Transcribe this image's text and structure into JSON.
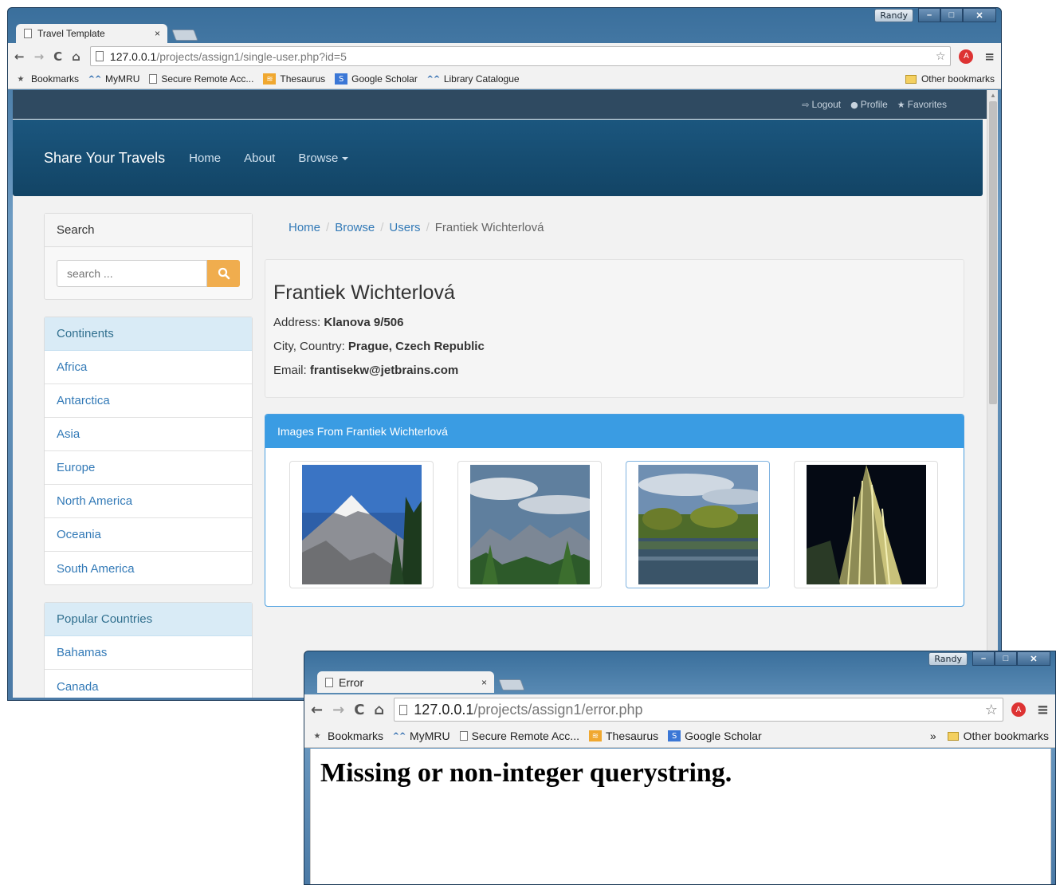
{
  "window1": {
    "profile": "Randy",
    "tab_title": "Travel Template",
    "url_host": "127.0.0.1",
    "url_path": "/projects/assign1/single-user.php?id=5",
    "bookmarks": [
      "Bookmarks",
      "MyMRU",
      "Secure Remote Acc...",
      "Thesaurus",
      "Google Scholar",
      "Library Catalogue"
    ],
    "other_bookmarks": "Other bookmarks",
    "page": {
      "top_links": [
        "Logout",
        "Profile",
        "Favorites"
      ],
      "brand": "Share Your Travels",
      "nav": [
        "Home",
        "About",
        "Browse"
      ],
      "search": {
        "title": "Search",
        "placeholder": "search ..."
      },
      "continents": {
        "title": "Continents",
        "items": [
          "Africa",
          "Antarctica",
          "Asia",
          "Europe",
          "North America",
          "Oceania",
          "South America"
        ]
      },
      "popular": {
        "title": "Popular Countries",
        "items": [
          "Bahamas",
          "Canada"
        ]
      },
      "breadcrumb": [
        "Home",
        "Browse",
        "Users",
        "Frantiek Wichterlová"
      ],
      "user": {
        "name": "Frantiek Wichterlová",
        "address_label": "Address:",
        "address": "Klanova 9/506",
        "city_label": "City, Country:",
        "city": "Prague, Czech Republic",
        "email_label": "Email:",
        "email": "frantisekw@jetbrains.com"
      },
      "images_title": "Images From Frantiek Wichterlová",
      "images": [
        "mountain-icon",
        "valley-icon",
        "lake-icon",
        "skyscraper-icon"
      ]
    }
  },
  "window2": {
    "profile": "Randy",
    "tab_title": "Error",
    "url_host": "127.0.0.1",
    "url_path": "/projects/assign1/error.php",
    "bookmarks": [
      "Bookmarks",
      "MyMRU",
      "Secure Remote Acc...",
      "Thesaurus",
      "Google Scholar"
    ],
    "more": "»",
    "other_bookmarks": "Other bookmarks",
    "message": "Missing or non-integer querystring."
  }
}
